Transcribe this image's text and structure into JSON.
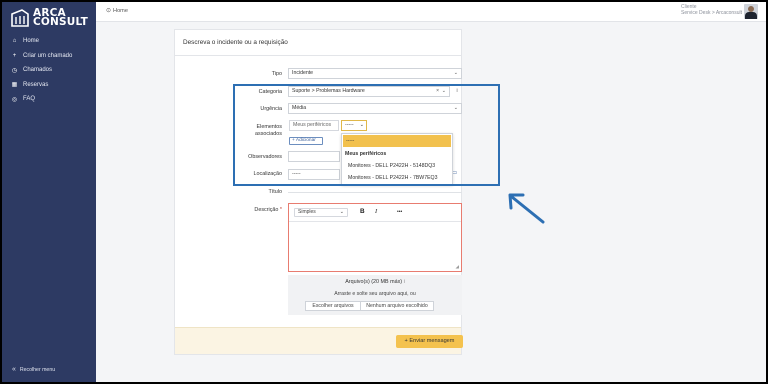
{
  "sidebar": {
    "logo_line1": "ARCA",
    "logo_line2": "CONSULT",
    "items": [
      {
        "icon": "home-icon",
        "glyph": "⌂",
        "label": "Home"
      },
      {
        "icon": "plus-icon",
        "glyph": "+",
        "label": "Criar um chamado"
      },
      {
        "icon": "clock-icon",
        "glyph": "◷",
        "label": "Chamados"
      },
      {
        "icon": "calendar-icon",
        "glyph": "▦",
        "label": "Reservas"
      },
      {
        "icon": "help-icon",
        "glyph": "◎",
        "label": "FAQ"
      }
    ],
    "collapse_label": "Recolher menu"
  },
  "topbar": {
    "breadcrumb": "Home",
    "user_name": "Cliente",
    "user_entity": "Service Desk > Arcaconsult"
  },
  "form": {
    "title": "Descreva o incidente ou a requisição",
    "tipo_label": "Tipo",
    "tipo_value": "Incidente",
    "categoria_label": "Categoria",
    "categoria_value": "Suporte > Problemas Hardware",
    "categoria_clear": "×",
    "categoria_info": "i",
    "urgencia_label": "Urgência",
    "urgencia_value": "Média",
    "elementos_label_1": "Elementos",
    "elementos_label_2": "associados",
    "periph_button": "Meus periféricos",
    "small_select_value": "-----",
    "add_button": "+ Adicionar",
    "observadores_label": "Observadores",
    "localizacao_label": "Localização",
    "localizacao_value": "-----",
    "titulo_label": "Título",
    "descricao_label": "Descrição",
    "required_mark": "*",
    "editor": {
      "format_value": "Simples",
      "bold": "B",
      "italic": "I",
      "more": "•••"
    },
    "upload": {
      "label": "Arquivo(s) (20 MB máx)",
      "info": "i",
      "drag_text": "Arraste e solte seu arquivo aqui, ou",
      "choose_button": "Escolher arquivos",
      "no_file": "Nenhum arquivo escolhido"
    },
    "submit_label": "+ Enviar mensagem"
  },
  "dropdown": {
    "search_value": "-----",
    "group_label": "Meus periféricos",
    "options": [
      "Monitores - DELL P2422H - 5148DQ3",
      "Monitores - DELL P2422H - 7BW7EQ3"
    ]
  },
  "colors": {
    "sidebar_bg": "#2d3a63",
    "highlight_border": "#2d6fb3",
    "accent_yellow": "#f4c24e",
    "required_red": "#c0392b"
  }
}
